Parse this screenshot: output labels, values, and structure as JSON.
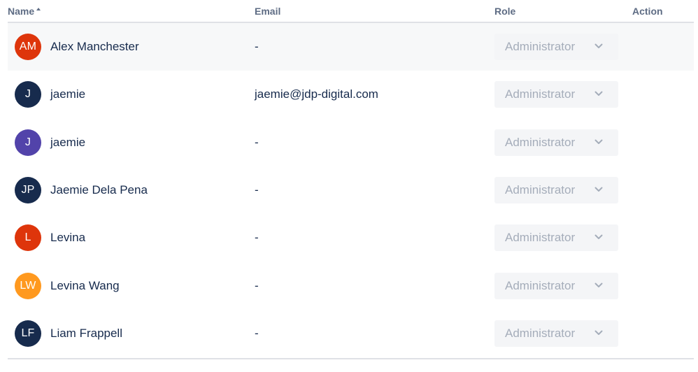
{
  "columns": {
    "name": "Name",
    "email": "Email",
    "role": "Role",
    "action": "Action"
  },
  "sort": {
    "column": "name",
    "direction": "ascending"
  },
  "rows": [
    {
      "initials": "AM",
      "avatar_color": "#de350b",
      "name": "Alex Manchester",
      "email": "-",
      "role": "Administrator"
    },
    {
      "initials": "J",
      "avatar_color": "#172b4d",
      "name": "jaemie",
      "email": "jaemie@jdp-digital.com",
      "role": "Administrator"
    },
    {
      "initials": "J",
      "avatar_color": "#5243aa",
      "name": "jaemie",
      "email": "-",
      "role": "Administrator"
    },
    {
      "initials": "JP",
      "avatar_color": "#172b4d",
      "name": "Jaemie Dela Pena",
      "email": "-",
      "role": "Administrator"
    },
    {
      "initials": "L",
      "avatar_color": "#de350b",
      "name": "Levina",
      "email": "-",
      "role": "Administrator"
    },
    {
      "initials": "LW",
      "avatar_color": "#ff991f",
      "name": "Levina Wang",
      "email": "-",
      "role": "Administrator"
    },
    {
      "initials": "LF",
      "avatar_color": "#172b4d",
      "name": "Liam Frappell",
      "email": "-",
      "role": "Administrator"
    }
  ],
  "colors": {
    "header_text": "#5e6c84",
    "body_text": "#172b4d",
    "disabled_text": "#a5adba",
    "select_bg": "#f4f5f7",
    "divider": "#dfe1e6",
    "hover_row": "#f7f8f9"
  }
}
